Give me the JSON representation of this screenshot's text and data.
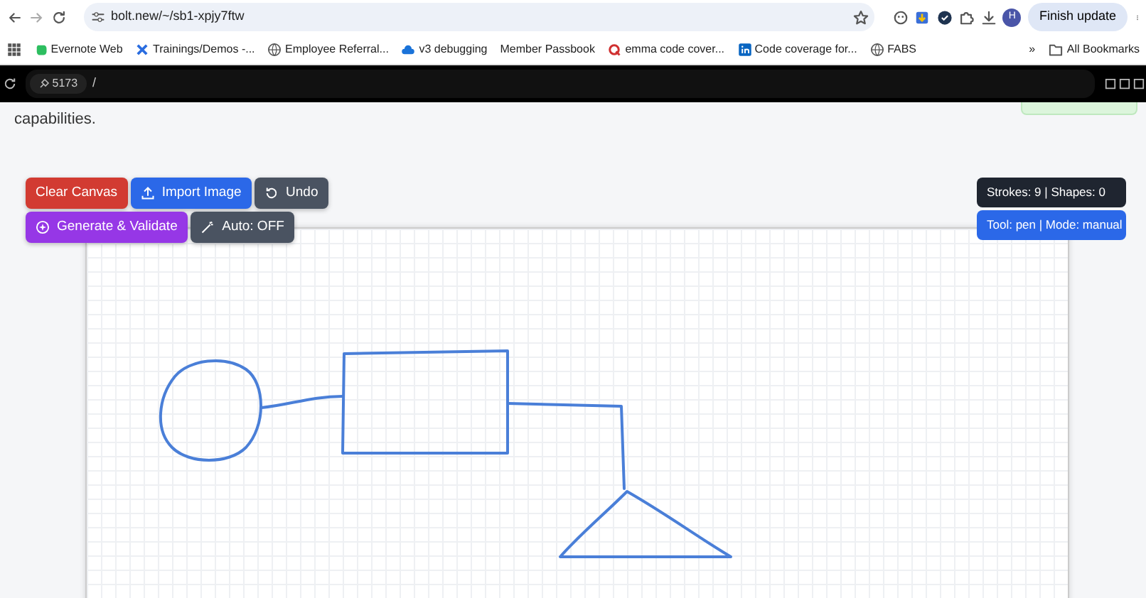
{
  "browser": {
    "url": "bolt.new/~/sb1-xpjy7ftw",
    "profile_initial": "H",
    "update_button": "Finish update",
    "bookmarks": [
      {
        "label": "Evernote Web",
        "kind": "evernote"
      },
      {
        "label": "Trainings/Demos -...",
        "kind": "cross"
      },
      {
        "label": "Employee Referral...",
        "kind": "globe"
      },
      {
        "label": "v3 debugging",
        "kind": "cloud"
      },
      {
        "label": "Member Passbook",
        "kind": "none"
      },
      {
        "label": "emma code cover...",
        "kind": "q"
      },
      {
        "label": "Code coverage for...",
        "kind": "linkedin"
      },
      {
        "label": "FABS",
        "kind": "globe"
      }
    ],
    "more_bookmarks": "»",
    "all_bookmarks": "All Bookmarks"
  },
  "devbar": {
    "port": "5173",
    "path": "/"
  },
  "page": {
    "intro_text": "capabilities.",
    "button_rows": [
      [
        {
          "label": "Clear Canvas",
          "kind": "none",
          "color": "#d23b32"
        },
        {
          "label": "Import Image",
          "kind": "upload",
          "color": "#2b68e8"
        },
        {
          "label": "Undo",
          "kind": "undo",
          "color": "#4a5361"
        }
      ],
      [
        {
          "label": "Generate & Validate",
          "kind": "generate",
          "color": "#9637e6"
        },
        {
          "label": "Auto: OFF",
          "kind": "wand",
          "color": "#4a5361"
        }
      ]
    ],
    "status": [
      {
        "text": "Strokes: 9 | Shapes: 0",
        "color": "#1f2530"
      },
      {
        "text": "Tool: pen | Mode: manual",
        "color": "#2b68e8"
      }
    ]
  }
}
